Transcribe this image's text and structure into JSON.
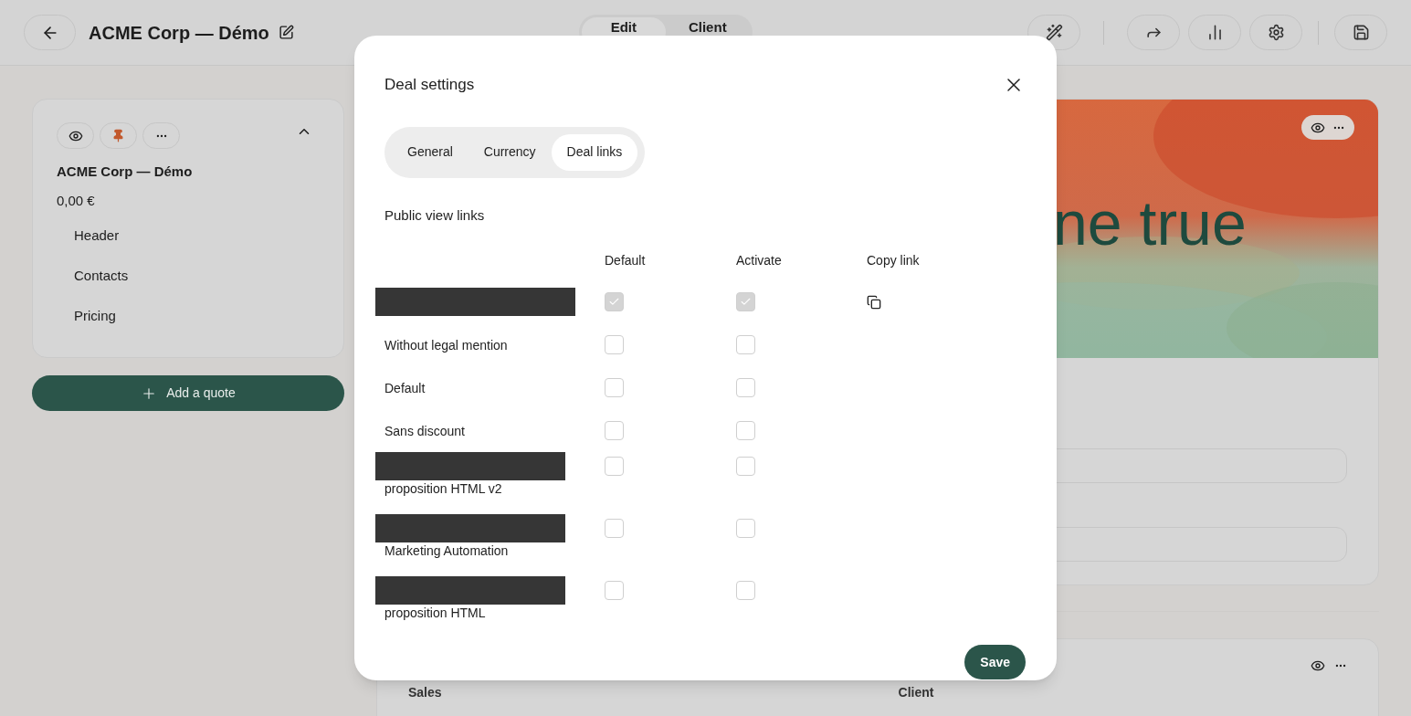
{
  "topbar": {
    "title": "ACME Corp — Démo",
    "mode_tabs": [
      {
        "label": "Edit",
        "selected": true
      },
      {
        "label": "Client",
        "selected": false
      }
    ]
  },
  "sidebar": {
    "title": "ACME Corp — Démo",
    "amount": "0,00 €",
    "sections": [
      "Header",
      "Contacts",
      "Pricing"
    ],
    "add_button": "Add a quote"
  },
  "hero": {
    "headline": "ne true"
  },
  "lower_card": {
    "labels": [
      "Sales",
      "Client"
    ]
  },
  "modal": {
    "title": "Deal settings",
    "tabs": [
      {
        "label": "General",
        "selected": false
      },
      {
        "label": "Currency",
        "selected": false
      },
      {
        "label": "Deal links",
        "selected": true
      }
    ],
    "section_title": "Public view links",
    "columns": [
      "Default",
      "Activate",
      "Copy link"
    ],
    "links": [
      {
        "redacted": true,
        "default": true,
        "activate": true,
        "disabled": true,
        "copyable": true
      },
      {
        "name": "Without legal mention",
        "redacted": false,
        "default": false,
        "activate": false,
        "disabled": false,
        "copyable": false
      },
      {
        "name": "Default",
        "redacted": false,
        "default": false,
        "activate": false,
        "disabled": false,
        "copyable": false
      },
      {
        "name": "Sans discount",
        "redacted": false,
        "default": false,
        "activate": false,
        "disabled": false,
        "copyable": false
      },
      {
        "name": "proposition HTML v2",
        "redacted": true,
        "default": false,
        "activate": false,
        "disabled": false,
        "copyable": false
      },
      {
        "name": "Marketing Automation",
        "redacted": true,
        "default": false,
        "activate": false,
        "disabled": false,
        "copyable": false
      },
      {
        "name": "proposition HTML",
        "redacted": true,
        "default": false,
        "activate": false,
        "disabled": false,
        "copyable": false
      }
    ],
    "save": "Save"
  }
}
